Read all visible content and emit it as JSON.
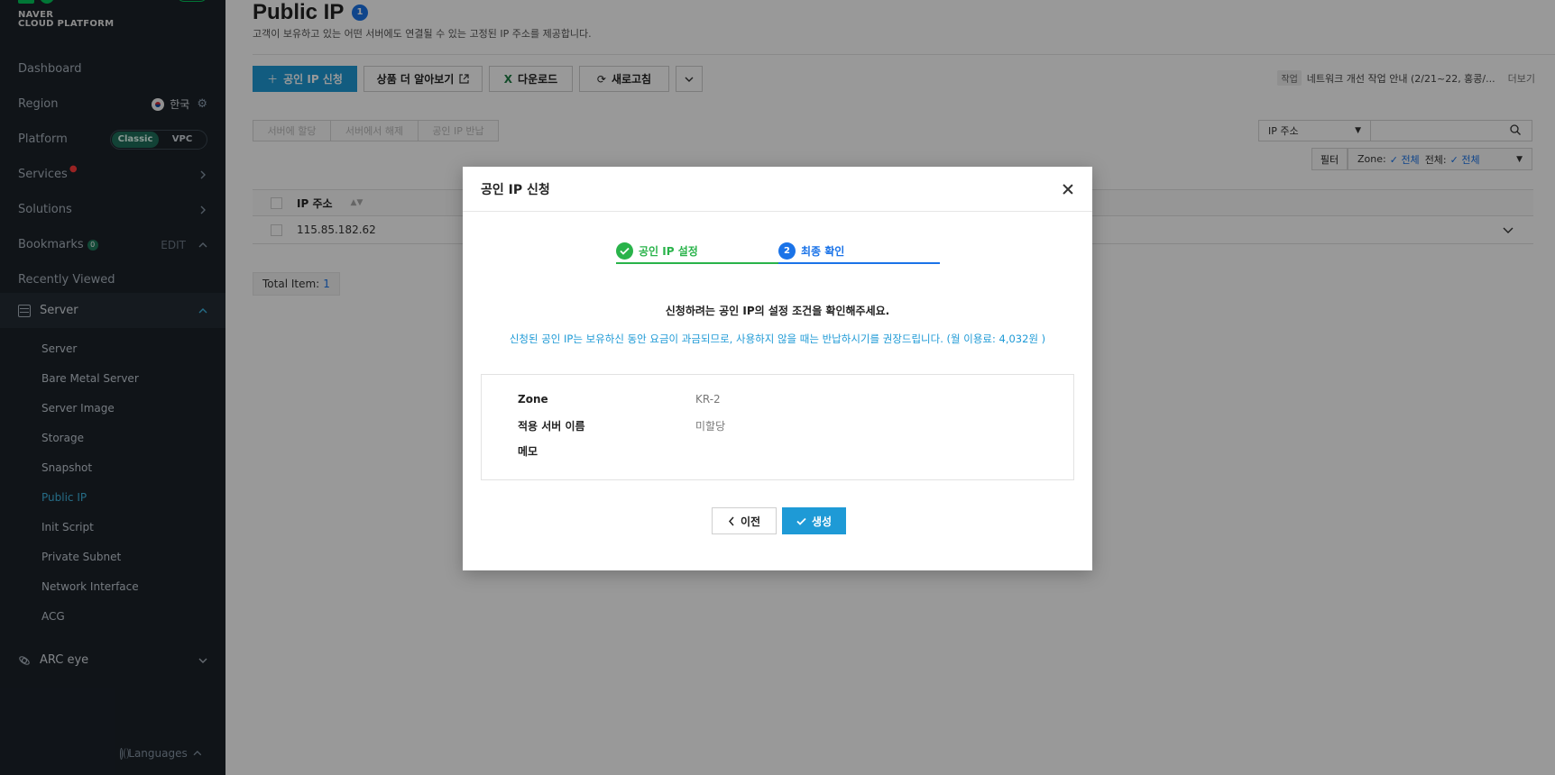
{
  "brand": {
    "line1": "NAVER",
    "line2": "CLOUD PLATFORM"
  },
  "sidebar": {
    "dashboard": "Dashboard",
    "region_label": "Region",
    "region_value": "한국",
    "platform_label": "Platform",
    "platform_options": [
      "Classic",
      "VPC"
    ],
    "platform_selected": "Classic",
    "services": "Services",
    "solutions": "Solutions",
    "bookmarks": "Bookmarks",
    "bookmarks_count": "0",
    "bookmarks_edit": "EDIT",
    "recently_viewed": "Recently Viewed",
    "server_group": "Server",
    "server_items": [
      "Server",
      "Bare Metal Server",
      "Server Image",
      "Storage",
      "Snapshot",
      "Public IP",
      "Init Script",
      "Private Subnet",
      "Network Interface",
      "ACG"
    ],
    "active_item": "Public IP",
    "arc_eye": "ARC eye",
    "languages": "Languages"
  },
  "page": {
    "title": "Public IP",
    "title_badge": "1",
    "description": "고객이 보유하고 있는 어떤 서버에도 연결될 수 있는 고정된 IP 주소를 제공합니다."
  },
  "toolbar": {
    "request_ip": "공인 IP 신청",
    "learn_more": "상품 더 알아보기",
    "download": "다운로드",
    "refresh": "새로고침"
  },
  "notice": {
    "tag": "작업",
    "text": "네트워크 개선 작업 안내 (2/21~22, 홍콩/...",
    "more": "더보기"
  },
  "actions": {
    "assign": "서버에 할당",
    "release": "서버에서 해제",
    "return": "공인 IP 반납"
  },
  "search": {
    "field": "IP 주소",
    "placeholder": ""
  },
  "filter": {
    "button": "필터",
    "zone_label": "Zone:",
    "zone_value": "전체",
    "all_label": "전체:",
    "all_value": "전체"
  },
  "table": {
    "header": "IP 주소",
    "rows": [
      "115.85.182.62"
    ]
  },
  "total": {
    "label": "Total Item:",
    "count": "1"
  },
  "modal": {
    "title": "공인 IP 신청",
    "step1": "공인 IP 설정",
    "step2": "최종 확인",
    "step2_num": "2",
    "question": "신청하려는 공인 IP의 설정 조건을 확인해주세요.",
    "warning": "신청된 공인 IP는 보유하신 동안 요금이 과금되므로, 사용하지 않을 때는 반납하시기를 권장드립니다. (월 이용료: 4,032원 )",
    "fields": [
      {
        "key": "Zone",
        "value": "KR-2"
      },
      {
        "key": "적용 서버 이름",
        "value": "미할당"
      },
      {
        "key": "메모",
        "value": ""
      }
    ],
    "prev_button": "이전",
    "create_button": "생성"
  },
  "colors": {
    "accent": "#1e9ad6",
    "step_done": "#29b34a",
    "step_current": "#1a73e8",
    "sidebar_bg": "#1b2229"
  }
}
